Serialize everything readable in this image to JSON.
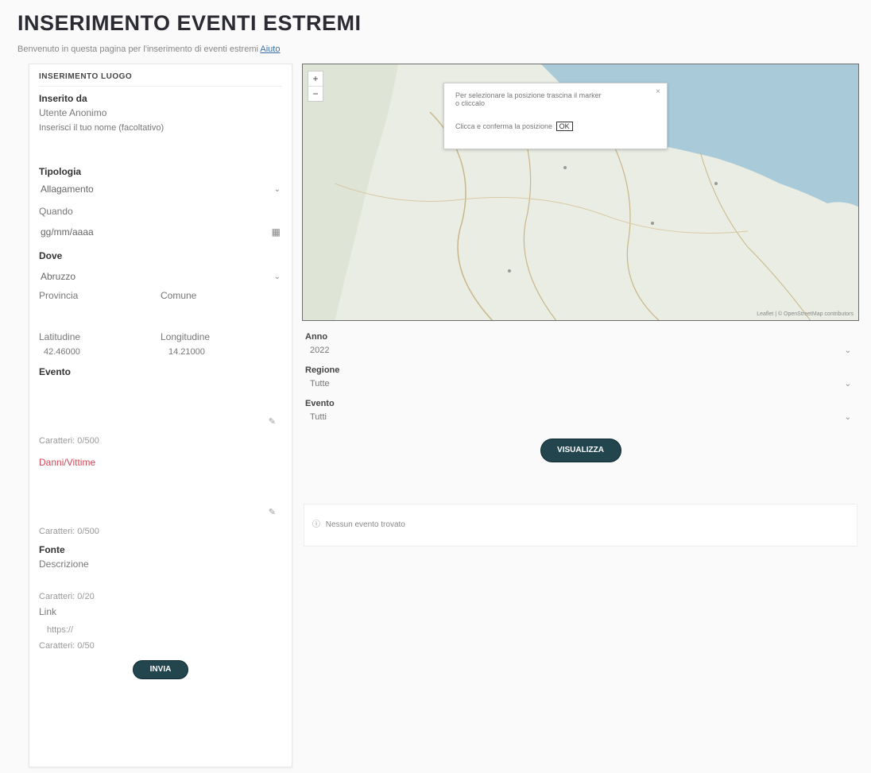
{
  "page": {
    "title": "INSERIMENTO EVENTI ESTREMI",
    "subtitle": "Benvenuto in questa pagina per l'inserimento di eventi estremi",
    "subtitle_link": "Aiuto"
  },
  "form": {
    "header": "INSERIMENTO LUOGO",
    "inserito_label": "Inserito da",
    "inserito_value": "Utente Anonimo",
    "inserito_note": "Inserisci il tuo nome (facoltativo)",
    "tipologia_label": "Tipologia",
    "tipologia_value": "Allagamento",
    "quando_label": "Quando",
    "quando_value": "gg/mm/aaaa",
    "dove_label": "Dove",
    "dove_value": "Abruzzo",
    "provincia_label": "Provincia",
    "comune_label": "Comune",
    "latitudine_label": "Latitudine",
    "latitudine_value": "42.46000",
    "longitudine_label": "Longitudine",
    "longitudine_value": "14.21000",
    "evento_label": "Evento",
    "evento_counter": "Caratteri: 0/500",
    "danni_label": "Danni/Vittime",
    "danni_counter": "Caratteri: 0/500",
    "fonte_label": "Fonte",
    "fonte_placeholder": "Descrizione",
    "fonte_counter": "Caratteri: 0/20",
    "link_label": "Link",
    "link_placeholder": "https://",
    "link_counter": "Caratteri: 0/50",
    "submit_label": "INVIA"
  },
  "map": {
    "zoom_in": "+",
    "zoom_out": "−",
    "popup_text": "Per selezionare la posizione trascina il marker",
    "popup_line2": "o cliccalo",
    "popup_confirm": "Clicca e conferma la posizione",
    "popup_button": "OK",
    "attribution": "Leaflet | © OpenStreetMap contributors"
  },
  "filters": {
    "anno_label": "Anno",
    "anno_value": "2022",
    "regione_label": "Regione",
    "regione_value": "Tutte",
    "evento_label": "Evento",
    "evento_value": "Tutti",
    "search_button": "VISUALIZZA",
    "results_text": "Nessun evento trovato"
  },
  "colors": {
    "accent": "#23454e",
    "sea": "#a9cbd9",
    "land": "#e9ece3",
    "error": "#d04a5a"
  }
}
